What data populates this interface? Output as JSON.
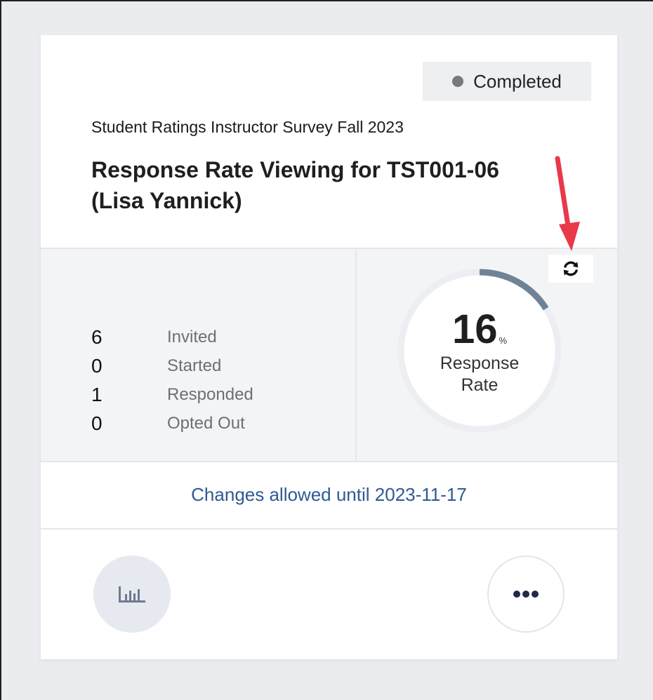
{
  "card": {
    "status_badge": "Completed",
    "survey_name": "Student Ratings Instructor Survey Fall 2023",
    "title": "Response Rate Viewing for TST001-06 (Lisa Yannick)",
    "stats": [
      {
        "value": "6",
        "label": "Invited"
      },
      {
        "value": "0",
        "label": "Started"
      },
      {
        "value": "1",
        "label": "Responded"
      },
      {
        "value": "0",
        "label": "Opted Out"
      }
    ],
    "response_rate": {
      "value": "16",
      "unit": "%",
      "label": "Response Rate",
      "fraction": 0.16
    },
    "changes_text": "Changes allowed until 2023-11-17"
  },
  "icons": {
    "status": "status-dot-icon",
    "refresh": "refresh-icon",
    "report": "bar-chart-icon",
    "more": "more-options-icon",
    "annotation": "red-arrow-icon"
  },
  "colors": {
    "status_dot": "#7a7a7a",
    "gauge_progress": "#6f8396",
    "gauge_track": "#eceef2",
    "link_text": "#2e5a92",
    "annotation_arrow": "#e8394a"
  }
}
